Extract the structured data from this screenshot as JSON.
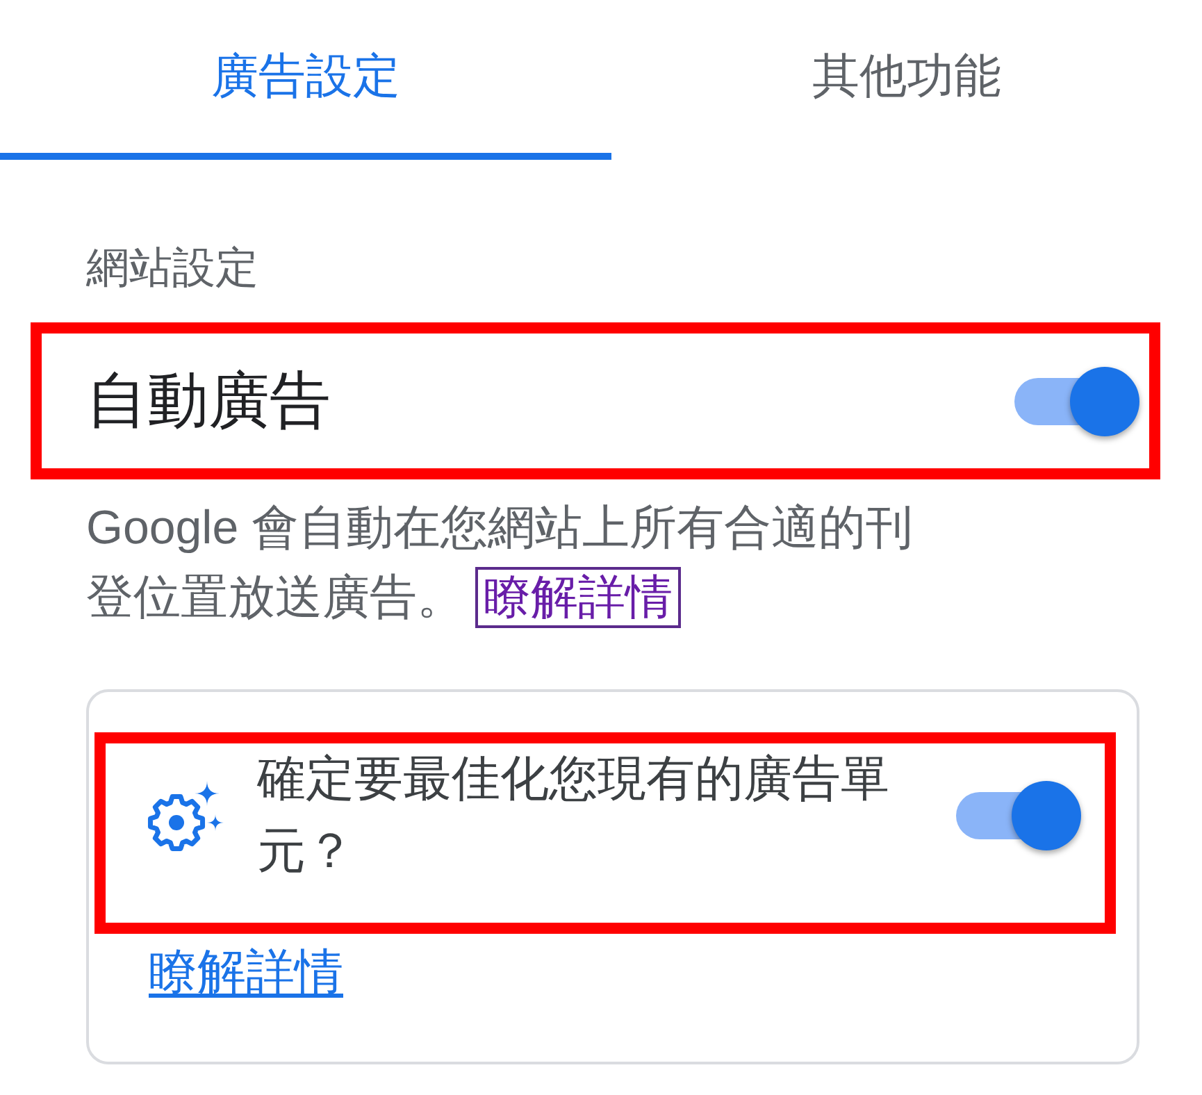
{
  "tabs": [
    {
      "label": "廣告設定",
      "selected": true
    },
    {
      "label": "其他功能",
      "selected": false
    }
  ],
  "site_settings": {
    "heading": "網站設定",
    "auto_ads": {
      "label": "自動廣告",
      "on": true,
      "highlighted": true
    },
    "description": {
      "text": "Google 會自動在您網站上所有合適的刊登位置放送廣告。",
      "link": {
        "label": "瞭解詳情",
        "visited": true,
        "focused": true
      }
    },
    "optimize_card": {
      "question": "確定要最佳化您現有的廣告單元？",
      "on": true,
      "highlighted": true,
      "link": {
        "label": "瞭解詳情",
        "visited": false,
        "focused": false
      }
    }
  }
}
